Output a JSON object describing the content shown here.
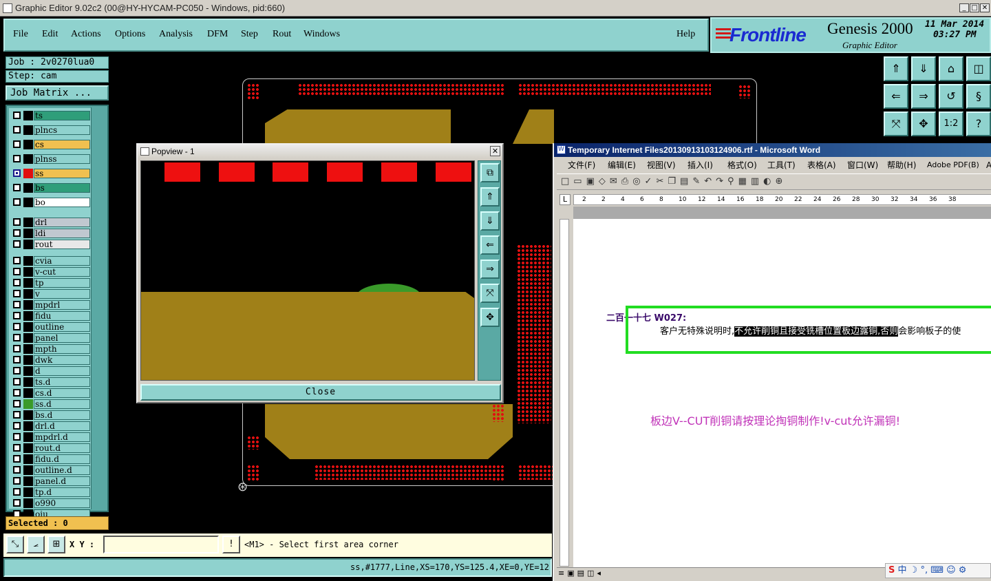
{
  "window": {
    "title": "Graphic Editor 9.02c2 (00@HY-HYCAM-PC050 - Windows, pid:660)"
  },
  "menu": {
    "items": [
      "File",
      "Edit",
      "Actions",
      "Options",
      "Analysis",
      "DFM",
      "Step",
      "Rout",
      "Windows"
    ],
    "help": "Help"
  },
  "brand": {
    "logo": "Frontline",
    "product": "Genesis 2000",
    "subtitle": "Graphic Editor",
    "date": "11 Mar 2014",
    "time": "03:27 PM"
  },
  "job": {
    "job_label": "Job : 2v0270lua0",
    "step_label": "Step: cam",
    "matrix_button": "Job Matrix ..."
  },
  "layers": [
    {
      "name": "ts",
      "color": "#2f9e7a",
      "checked": false
    },
    {
      "name": "plncs",
      "color": "#8fd2ce",
      "checked": false
    },
    {
      "name": "cs",
      "color": "#f0c050",
      "checked": false
    },
    {
      "name": "plnss",
      "color": "#8fd2ce",
      "checked": false
    },
    {
      "name": "ss",
      "color": "#f0c050",
      "checked": true,
      "swatch": "#e01010"
    },
    {
      "name": "bs",
      "color": "#2f9e7a",
      "checked": false
    },
    {
      "name": "bo",
      "color": "#ffffff",
      "checked": false
    },
    {
      "name": "drl",
      "color": "#c0c8d0",
      "checked": false
    },
    {
      "name": "ldi",
      "color": "#c0c8d0",
      "checked": false
    },
    {
      "name": "rout",
      "color": "#e8e8e8",
      "checked": false
    },
    {
      "name": "cvia",
      "color": "#8fd2ce",
      "checked": false
    },
    {
      "name": "v-cut",
      "color": "#8fd2ce",
      "checked": false
    },
    {
      "name": "tp",
      "color": "#8fd2ce",
      "checked": false
    },
    {
      "name": "v",
      "color": "#8fd2ce",
      "checked": false
    },
    {
      "name": "mpdrl",
      "color": "#8fd2ce",
      "checked": false
    },
    {
      "name": "fidu",
      "color": "#8fd2ce",
      "checked": false
    },
    {
      "name": "outline",
      "color": "#8fd2ce",
      "checked": false
    },
    {
      "name": "panel",
      "color": "#8fd2ce",
      "checked": false
    },
    {
      "name": "mpth",
      "color": "#8fd2ce",
      "checked": false
    },
    {
      "name": "dwk",
      "color": "#8fd2ce",
      "checked": false
    },
    {
      "name": "d",
      "color": "#8fd2ce",
      "checked": false
    },
    {
      "name": "ts.d",
      "color": "#8fd2ce",
      "checked": false
    },
    {
      "name": "cs.d",
      "color": "#8fd2ce",
      "checked": false
    },
    {
      "name": "ss.d",
      "color": "#8fd2ce",
      "checked": false,
      "swatch": "#3a9a2a"
    },
    {
      "name": "bs.d",
      "color": "#8fd2ce",
      "checked": false
    },
    {
      "name": "drl.d",
      "color": "#8fd2ce",
      "checked": false
    },
    {
      "name": "mpdrl.d",
      "color": "#8fd2ce",
      "checked": false
    },
    {
      "name": "rout.d",
      "color": "#8fd2ce",
      "checked": false
    },
    {
      "name": "fidu.d",
      "color": "#8fd2ce",
      "checked": false
    },
    {
      "name": "outline.d",
      "color": "#8fd2ce",
      "checked": false
    },
    {
      "name": "panel.d",
      "color": "#8fd2ce",
      "checked": false
    },
    {
      "name": "tp.d",
      "color": "#8fd2ce",
      "checked": false
    },
    {
      "name": "o990",
      "color": "#8fd2ce",
      "checked": false
    },
    {
      "name": "oiu",
      "color": "#8fd2ce",
      "checked": false
    }
  ],
  "selected": "Selected : 0",
  "popview": {
    "title": "Popview - 1",
    "close_label": "Close"
  },
  "word": {
    "title": "Temporary Internet Files20130913103124906.rtf - Microsoft Word",
    "menus": [
      "文件(F)",
      "编辑(E)",
      "视图(V)",
      "插入(I)",
      "格式(O)",
      "工具(T)",
      "表格(A)",
      "窗口(W)",
      "帮助(H)",
      "Adobe PDF(B)",
      "A"
    ],
    "ruler": [
      "2",
      "2",
      "4",
      "6",
      "8",
      "10",
      "12",
      "14",
      "16",
      "18",
      "20",
      "22",
      "24",
      "26",
      "28",
      "30",
      "32",
      "34",
      "36",
      "38"
    ],
    "heading": "二百一十七 W027:",
    "body_prefix": "客户无特殊说明时,",
    "body_highlight": "不允许削铜且接受铣槽位置板边露铜,否则",
    "body_suffix": "会影响板子的使",
    "note": "板边V--CUT削铜请按理论掏铜制作!v-cut允许漏铜!",
    "highlight_box_color": "#22dd22"
  },
  "command": {
    "xy_label": "X Y :",
    "xy_value": "",
    "prompt": "<M1> - Select first area corner"
  },
  "status": "ss,#1777,Line,XS=170,YS=125.4,XE=0,YE=12",
  "ime": {
    "label": "中"
  }
}
